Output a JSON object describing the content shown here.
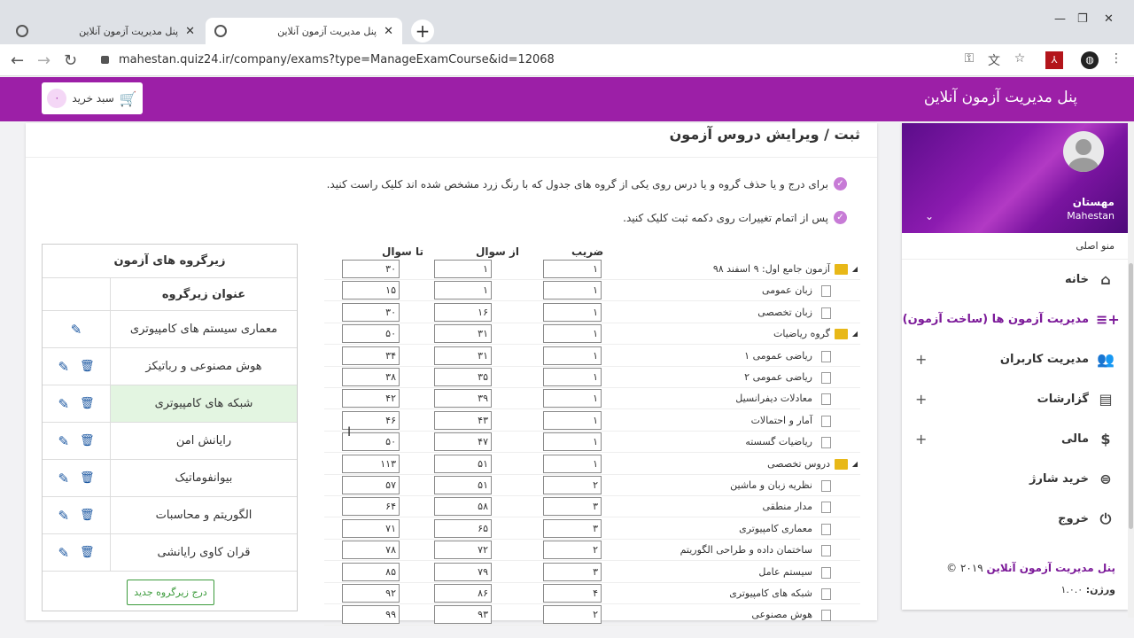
{
  "browser": {
    "tabs": [
      {
        "title": "پنل مدیریت آزمون آنلاین",
        "active": false
      },
      {
        "title": "پنل مدیریت آزمون آنلاین",
        "active": true
      }
    ],
    "url": "mahestan.quiz24.ir/company/exams?type=ManageExamCourse&id=12068"
  },
  "header": {
    "brand": "پنل مدیریت آزمون آنلاین",
    "cart_label": "سبد خرید",
    "cart_count": "۰",
    "color": "#9c1fa7"
  },
  "sidebar": {
    "user_name": "مهستان",
    "user_sub": "Mahestan",
    "main_menu_label": "منو اصلی",
    "items": [
      {
        "label": "خانه",
        "icon": "home-icon",
        "active": false,
        "expandable": false
      },
      {
        "label": "مدیریت آزمون ها (ساخت آزمون)",
        "icon": "playlist-add-icon",
        "active": true,
        "expandable": false
      },
      {
        "label": "مدیریت کاربران",
        "icon": "people-icon",
        "active": false,
        "expandable": true
      },
      {
        "label": "گزارشات",
        "icon": "report-icon",
        "active": false,
        "expandable": true
      },
      {
        "label": "مالی",
        "icon": "dollar-icon",
        "active": false,
        "expandable": true
      },
      {
        "label": "خرید شارژ",
        "icon": "coin-icon",
        "active": false,
        "expandable": false
      },
      {
        "label": "خروج",
        "icon": "power-icon",
        "active": false,
        "expandable": false
      }
    ],
    "footer_brand": "پنل مدیریت آزمون آنلاین",
    "footer_year": "۲۰۱۹ ©",
    "version_label": "ورژن:",
    "version": "۱.۰.۰"
  },
  "page": {
    "title": "ثبت / ویرایش دروس آزمون",
    "note1": "برای درج و یا حذف گروه و یا درس روی یکی از گروه های جدول که با رنگ زرد مشخص شده اند کلیک راست کنید.",
    "note2": "پس از اتمام تغییرات روی دکمه ثبت کلیک کنید."
  },
  "subgroups": {
    "title": "زیرگروه های آزمون",
    "column": "عنوان زیرگروه",
    "rows": [
      {
        "title": "معماری سیستم های کامپیوتری",
        "deletable": false,
        "highlight": false
      },
      {
        "title": "هوش مصنوعی و رباتیکز",
        "deletable": true,
        "highlight": false
      },
      {
        "title": "شبکه های کامپیوتری",
        "deletable": true,
        "highlight": true
      },
      {
        "title": "رایانش امن",
        "deletable": true,
        "highlight": false
      },
      {
        "title": "بیوانفوماتیک",
        "deletable": true,
        "highlight": false
      },
      {
        "title": "الگوریتم و محاسبات",
        "deletable": true,
        "highlight": false
      },
      {
        "title": "قران کاوی رایانشی",
        "deletable": true,
        "highlight": false
      }
    ],
    "new_button": "درج زیرگروه جدید"
  },
  "courses": {
    "col_coef": "ضریب",
    "col_from": "از سوال",
    "col_to": "تا سوال",
    "rows": [
      {
        "label": "آزمون جامع اول: ۹ اسفند ۹۸",
        "type": "folder",
        "coef": "۱",
        "from": "۱",
        "to": "۳۰"
      },
      {
        "label": "زبان عمومی",
        "type": "doc",
        "coef": "۱",
        "from": "۱",
        "to": "۱۵"
      },
      {
        "label": "زبان تخصصی",
        "type": "doc",
        "coef": "۱",
        "from": "۱۶",
        "to": "۳۰"
      },
      {
        "label": "گروه ریاضیات",
        "type": "folder",
        "coef": "۱",
        "from": "۳۱",
        "to": "۵۰"
      },
      {
        "label": "ریاضی عمومی ۱",
        "type": "doc",
        "coef": "۱",
        "from": "۳۱",
        "to": "۳۴"
      },
      {
        "label": "ریاضی عمومی ۲",
        "type": "doc",
        "coef": "۱",
        "from": "۳۵",
        "to": "۳۸"
      },
      {
        "label": "معادلات دیفرانسیل",
        "type": "doc",
        "coef": "۱",
        "from": "۳۹",
        "to": "۴۲"
      },
      {
        "label": "آمار و احتمالات",
        "type": "doc",
        "coef": "۱",
        "from": "۴۳",
        "to": "۴۶"
      },
      {
        "label": "ریاضیات گسسته",
        "type": "doc",
        "coef": "۱",
        "from": "۴۷",
        "to": "۵۰"
      },
      {
        "label": "دروس تخصصی",
        "type": "folder",
        "coef": "۱",
        "from": "۵۱",
        "to": "۱۱۳"
      },
      {
        "label": "نظریه زبان و ماشین",
        "type": "doc",
        "coef": "۲",
        "from": "۵۱",
        "to": "۵۷"
      },
      {
        "label": "مدار منطقی",
        "type": "doc",
        "coef": "۳",
        "from": "۵۸",
        "to": "۶۴"
      },
      {
        "label": "معماری کامپیوتری",
        "type": "doc",
        "coef": "۳",
        "from": "۶۵",
        "to": "۷۱"
      },
      {
        "label": "ساختمان داده و طراحی الگوریتم",
        "type": "doc",
        "coef": "۲",
        "from": "۷۲",
        "to": "۷۸"
      },
      {
        "label": "سیستم عامل",
        "type": "doc",
        "coef": "۳",
        "from": "۷۹",
        "to": "۸۵"
      },
      {
        "label": "شبکه های کامپیوتری",
        "type": "doc",
        "coef": "۴",
        "from": "۸۶",
        "to": "۹۲"
      },
      {
        "label": "هوش مصنوعی",
        "type": "doc",
        "coef": "۲",
        "from": "۹۳",
        "to": "۹۹"
      }
    ]
  }
}
